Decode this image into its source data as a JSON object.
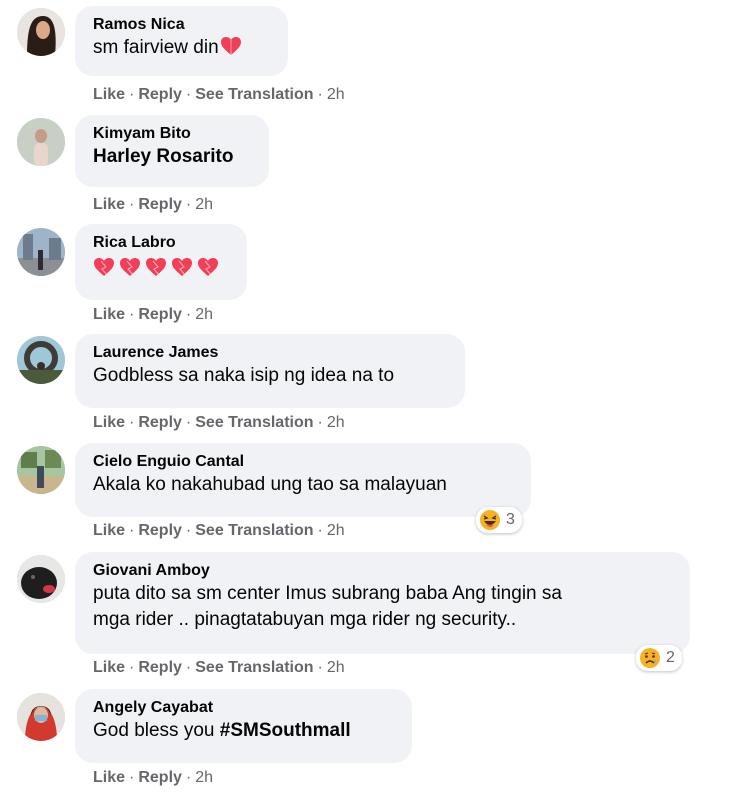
{
  "comments": [
    {
      "name": "Ramos Nica",
      "text": "sm fairview din",
      "like": "Like",
      "reply": "Reply",
      "translate": "See Translation",
      "time": "2h"
    },
    {
      "name": "Kimyam Bito",
      "text": "Harley Rosarito",
      "like": "Like",
      "reply": "Reply",
      "time": "2h"
    },
    {
      "name": "Rica Labro",
      "like": "Like",
      "reply": "Reply",
      "time": "2h",
      "icons": [
        "heart-icon",
        "heart-icon",
        "heart-icon",
        "heart-icon",
        "heart-icon"
      ]
    },
    {
      "name": "Laurence James",
      "text": "Godbless sa naka isip ng idea na to",
      "like": "Like",
      "reply": "Reply",
      "translate": "See Translation",
      "time": "2h"
    },
    {
      "name": "Cielo Enguio Cantal",
      "text": "Akala ko nakahubad ung tao sa malayuan",
      "like": "Like",
      "reply": "Reply",
      "translate": "See Translation",
      "time": "2h",
      "reaction": {
        "icon": "laughing-emoji-icon",
        "count": "3"
      }
    },
    {
      "name": "Giovani Amboy",
      "text_line1": "puta dito sa sm center Imus subrang baba Ang tingin sa",
      "text_line2": "mga rider .. pinagtatabuyan mga rider ng security..",
      "like": "Like",
      "reply": "Reply",
      "translate": "See Translation",
      "time": "2h",
      "reaction": {
        "icon": "sad-emoji-icon",
        "count": "2"
      }
    },
    {
      "name": "Angely Cayabat",
      "text": "God bless you ",
      "hashtag": "#SMSouthmall",
      "like": "Like",
      "reply": "Reply",
      "time": "2h"
    }
  ],
  "colors": {
    "bubble": "#f0f2f5",
    "meta": "#65676b",
    "heart": "#f33e58",
    "emoji": "#f7b125"
  }
}
